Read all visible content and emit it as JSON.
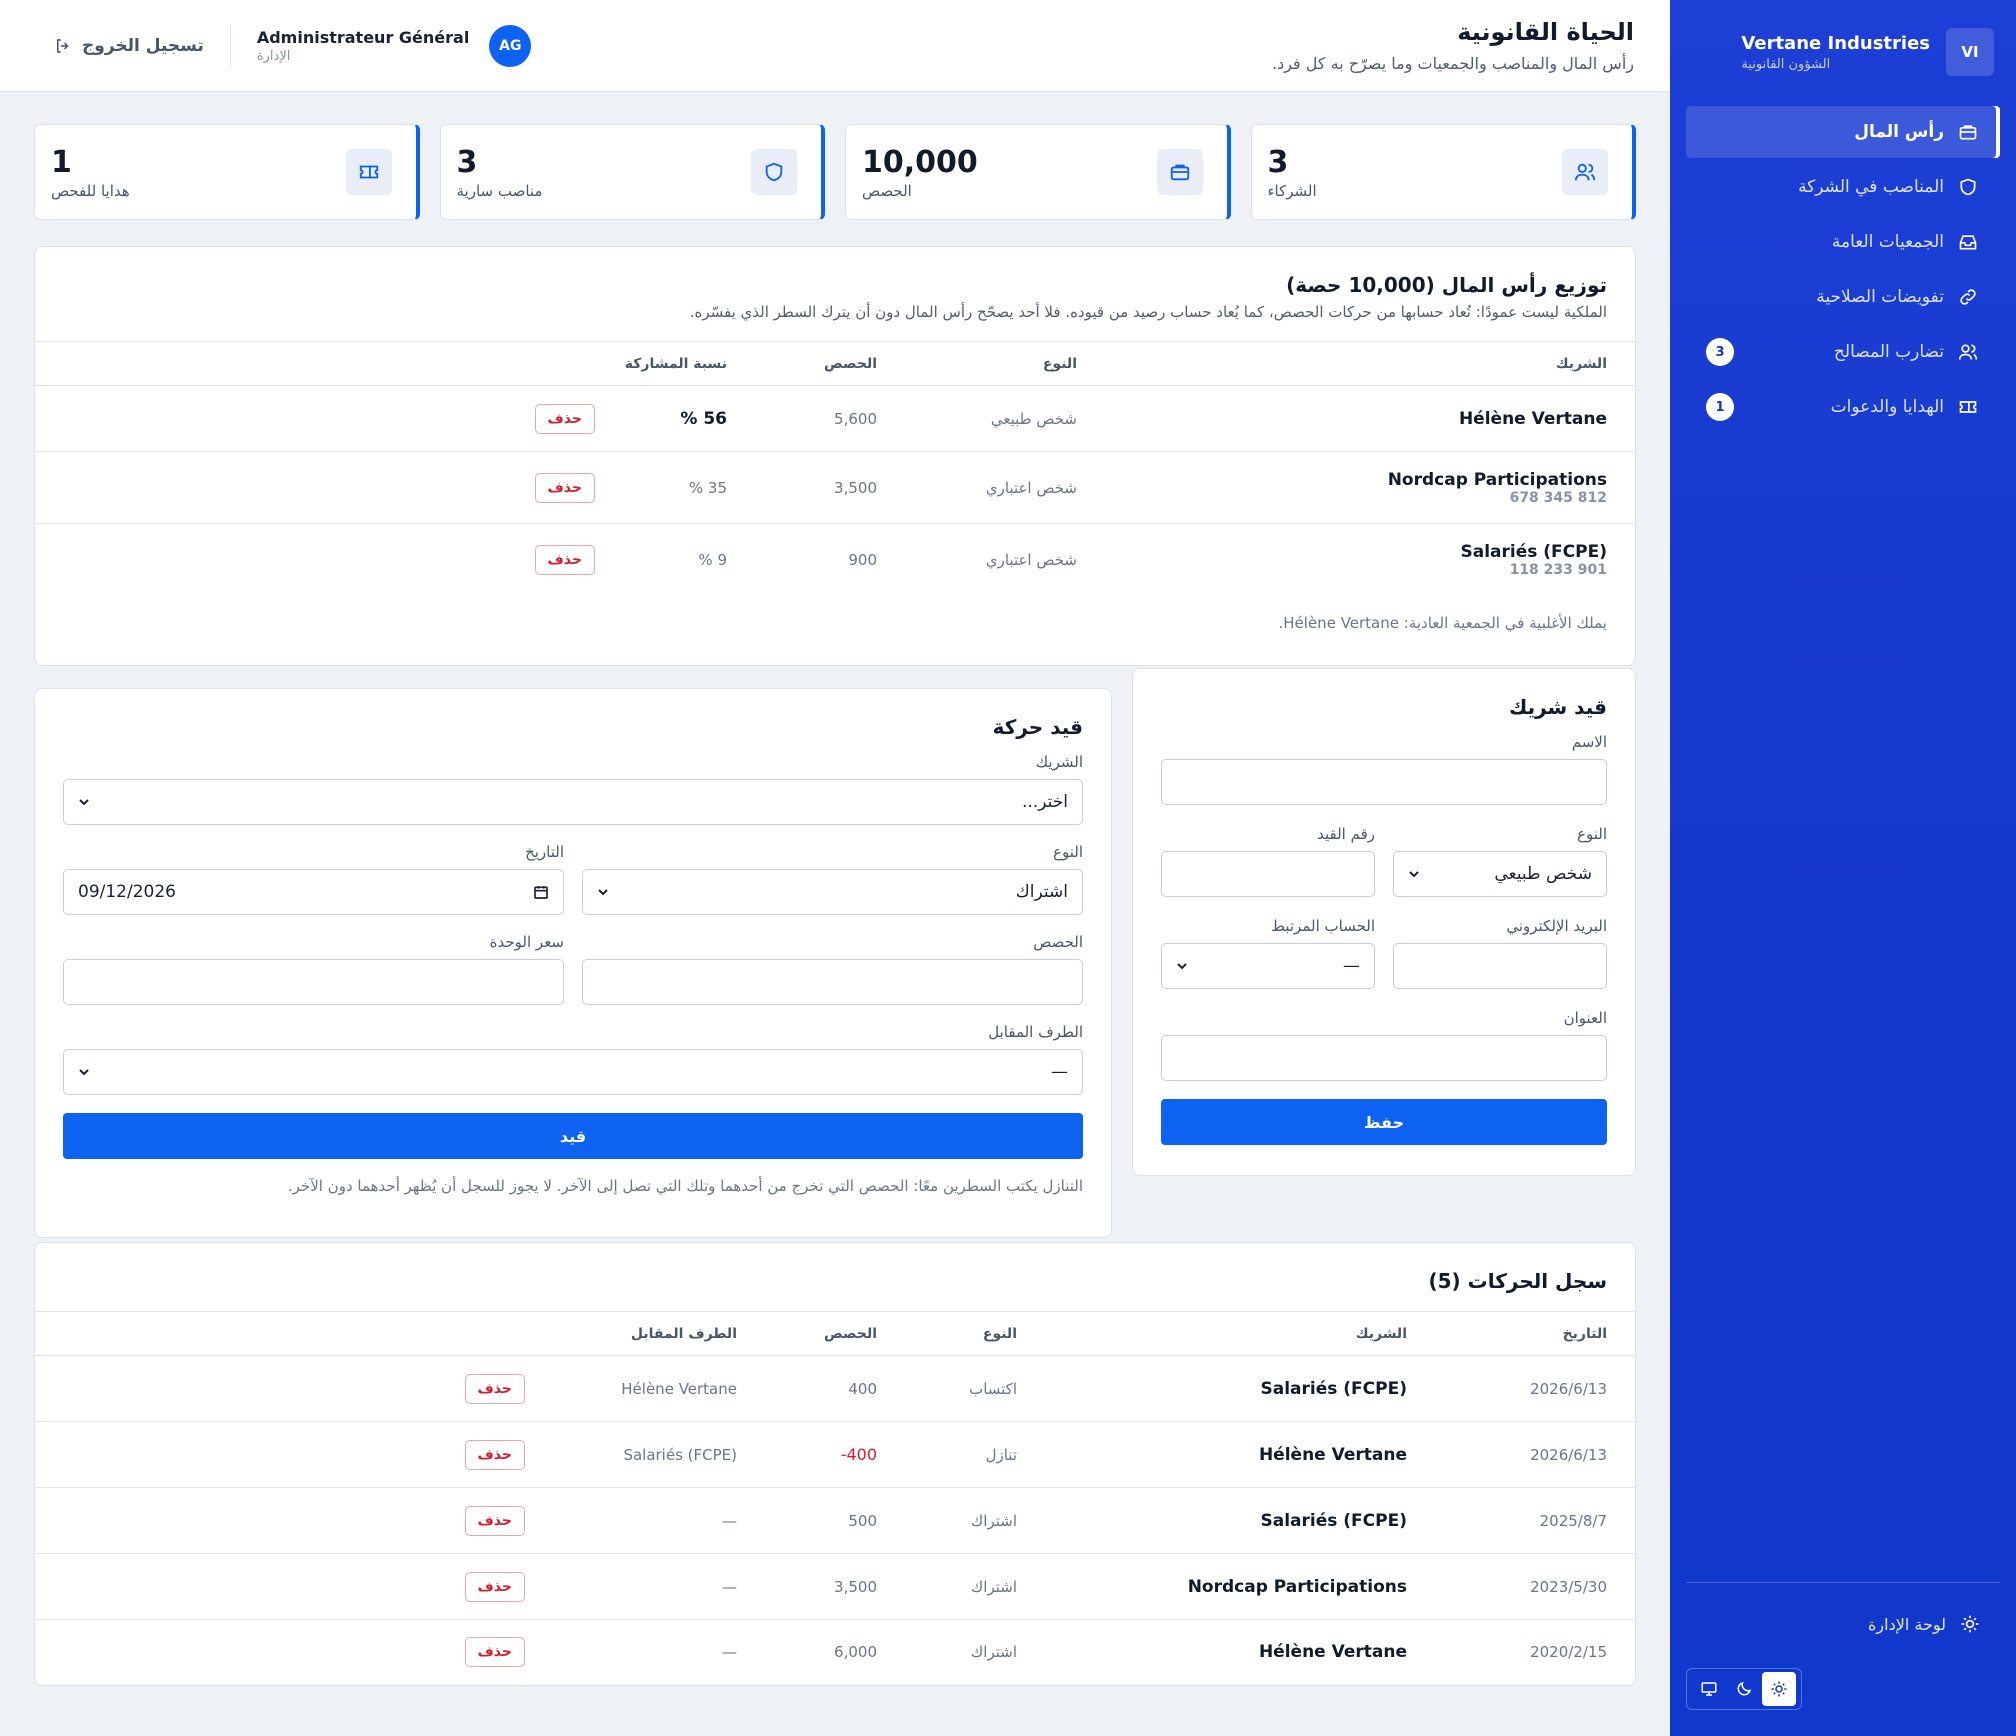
{
  "header": {
    "title": "الحياة القانونية",
    "subtitle": "رأس المال والمناصب والجمعيات وما يصرّح به كل فرد.",
    "avatar": "AG",
    "user_name": "Administrateur Général",
    "user_role": "الإدارة",
    "logout": "تسجيل الخروج"
  },
  "stats": [
    {
      "value": "3",
      "label": "الشركاء",
      "icon": "users-icon"
    },
    {
      "value": "10,000",
      "label": "الحصص",
      "icon": "briefcase-icon"
    },
    {
      "value": "3",
      "label": "مناصب سارية",
      "icon": "shield-icon"
    },
    {
      "value": "1",
      "label": "هدايا للفحص",
      "icon": "ticket-icon"
    }
  ],
  "distribution": {
    "title": "توزيع رأس المال (10,000 حصة)",
    "subtitle": "الملكية ليست عمودًا: تُعاد حسابها من حركات الحصص، كما يُعاد حساب رصيد من قيوده. فلا أحد يصحّح رأس المال دون أن يترك السطر الذي يفسّره.",
    "headers": [
      "الشريك",
      "النوع",
      "الحصص",
      "نسبة المشاركة"
    ],
    "rows": [
      {
        "name": "Hélène Vertane",
        "reg": "",
        "type": "شخص طبيعي",
        "shares": "5,600",
        "pct": "56 %"
      },
      {
        "name": "Nordcap Participations",
        "reg": "678 345 812",
        "type": "شخص اعتباري",
        "shares": "3,500",
        "pct": "35 %"
      },
      {
        "name": "Salariés (FCPE)",
        "reg": "118 233 901",
        "type": "شخص اعتباري",
        "shares": "900",
        "pct": "9 %"
      }
    ],
    "delete_label": "حذف",
    "majority_note": "يملك الأغلبية في الجمعية العادية: Hélène Vertane."
  },
  "partner_form": {
    "title": "قيد شريك",
    "name_label": "الاسم",
    "type_label": "النوع",
    "type_value": "شخص طبيعي",
    "reg_label": "رقم القيد",
    "email_label": "البريد الإلكتروني",
    "account_label": "الحساب المرتبط",
    "account_value": "—",
    "address_label": "العنوان",
    "save": "حفظ"
  },
  "movement_form": {
    "title": "قيد حركة",
    "partner_label": "الشريك",
    "partner_value": "اختر...",
    "type_label": "النوع",
    "type_value": "اشتراك",
    "date_label": "التاريخ",
    "date_value": "09/12/2026",
    "shares_label": "الحصص",
    "unit_price_label": "سعر الوحدة",
    "counterparty_label": "الطرف المقابل",
    "counterparty_value": "—",
    "submit": "قيد",
    "note": "التنازل يكتب السطرين معًا: الحصص التي تخرج من أحدهما وتلك التي تصل إلى الآخر. لا يجوز للسجل أن يُظهر أحدهما دون الآخر."
  },
  "log": {
    "title": "سجل الحركات (5)",
    "headers": [
      "التاريخ",
      "الشريك",
      "النوع",
      "الحصص",
      "الطرف المقابل"
    ],
    "rows": [
      {
        "date": "2026/6/13",
        "partner": "Salariés (FCPE)",
        "type": "اكتساب",
        "shares": "400",
        "counter": "Hélène Vertane"
      },
      {
        "date": "2026/6/13",
        "partner": "Hélène Vertane",
        "type": "تنازل",
        "shares": "-400",
        "counter": "Salariés (FCPE)"
      },
      {
        "date": "2025/8/7",
        "partner": "Salariés (FCPE)",
        "type": "اشتراك",
        "shares": "500",
        "counter": "—"
      },
      {
        "date": "2023/5/30",
        "partner": "Nordcap Participations",
        "type": "اشتراك",
        "shares": "3,500",
        "counter": "—"
      },
      {
        "date": "2020/2/15",
        "partner": "Hélène Vertane",
        "type": "اشتراك",
        "shares": "6,000",
        "counter": "—"
      }
    ],
    "delete_label": "حذف"
  },
  "sidebar": {
    "logo": "VI",
    "company": "Vertane Industries",
    "section": "الشؤون القانونية",
    "items": [
      {
        "label": "رأس المال",
        "icon": "briefcase-icon",
        "badge": ""
      },
      {
        "label": "المناصب في الشركة",
        "icon": "shield-icon",
        "badge": ""
      },
      {
        "label": "الجمعيات العامة",
        "icon": "inbox-icon",
        "badge": ""
      },
      {
        "label": "تفويضات الصلاحية",
        "icon": "link-icon",
        "badge": ""
      },
      {
        "label": "تضارب المصالح",
        "icon": "users-icon",
        "badge": "3"
      },
      {
        "label": "الهدايا والدعوات",
        "icon": "ticket-icon",
        "badge": "1"
      }
    ],
    "admin_link": "لوحة الإدارة"
  },
  "colors": {
    "accent": "#0d62f2",
    "sidebar": "#1337c8",
    "danger": "#d51d2c"
  }
}
